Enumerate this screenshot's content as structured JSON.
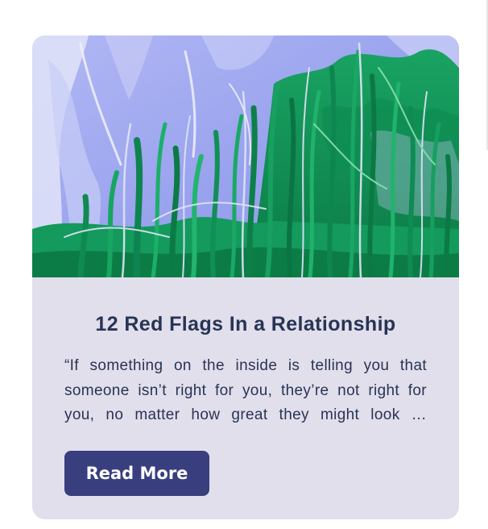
{
  "card": {
    "image": {
      "subject": "green and lavender abstract paint strokes",
      "colors": {
        "sky": "#a5adf0",
        "pale": "#d8dcf6",
        "green": "#12955a",
        "dark_green": "#0a6e3f",
        "light_green": "#58c98a"
      }
    },
    "title": "12 Red Flags In a Relationship",
    "excerpt": "“If something on the inside is telling you that someone isn’t right for you, they’re not right for you, no matter how great they might look …",
    "read_more_label": "Read More"
  },
  "colors": {
    "card_background": "#e1dfeb",
    "text": "#283455",
    "button_background": "#383e7e",
    "button_text": "#ffffff"
  }
}
